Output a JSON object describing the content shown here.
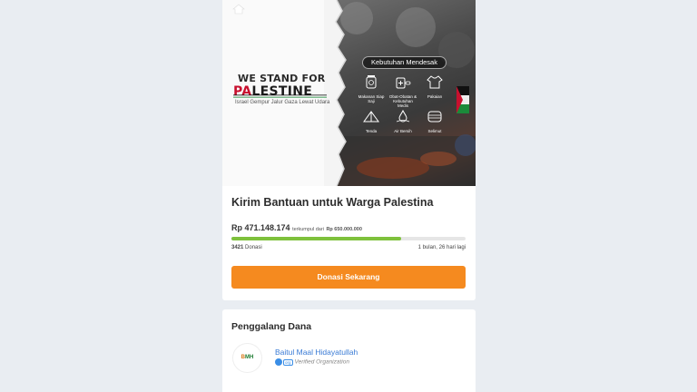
{
  "hero": {
    "headline_1": "WE STAND FOR",
    "headline_2_accent": "PA",
    "headline_2_rest": "LESTINE",
    "tagline": "Israel Gempur Jalur Gaza Lewat Udara",
    "needs_title": "Kebutuhan Mendesak",
    "needs": [
      {
        "label": "Makanan Siap Saji",
        "icon": "food-jar-icon"
      },
      {
        "label": "Obat-Obatan & Kebutuhan Medis",
        "icon": "medicine-icon"
      },
      {
        "label": "Pakaian",
        "icon": "clothes-icon"
      },
      {
        "label": "Tenda",
        "icon": "tent-icon"
      },
      {
        "label": "Air Bersih",
        "icon": "water-icon"
      },
      {
        "label": "Selimut",
        "icon": "blanket-icon"
      }
    ]
  },
  "campaign": {
    "title": "Kirim Bantuan untuk Warga Palestina",
    "raised_amount": "Rp 471.148.174",
    "raised_suffix": "terkumpul dari",
    "target_amount": "Rp 650.000.000",
    "progress_fraction": 0.725,
    "donor_count": "3421",
    "donor_label": "Donasi",
    "time_left": "1 bulan, 26 hari lagi",
    "donate_button": "Donasi Sekarang"
  },
  "organizer": {
    "heading": "Penggalang Dana",
    "logo_text_1": "B",
    "logo_text_2": "MH",
    "name": "Baitul Maal Hidayatullah",
    "badge": "org",
    "verified_label": "Verified Organization"
  },
  "colors": {
    "accent_orange": "#f58a1f",
    "progress_green": "#7ec13c",
    "link_blue": "#3a7bd5",
    "page_bg": "#e9edf2"
  }
}
